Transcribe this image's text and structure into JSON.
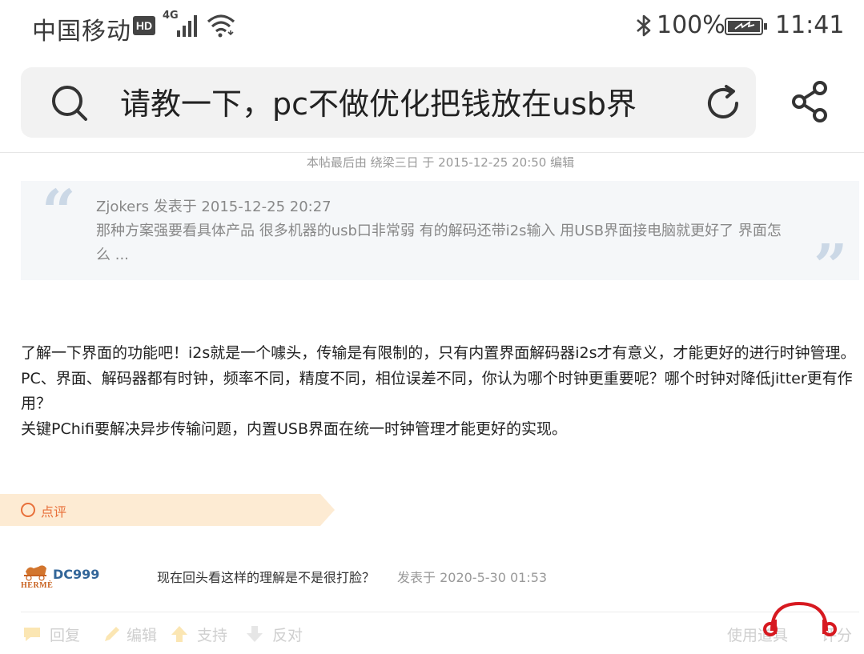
{
  "status_bar": {
    "carrier": "中国移动",
    "hd_badge": "HD",
    "network": "4G",
    "battery_percent": "100%",
    "time": "11:41"
  },
  "search_bar": {
    "query": "请教一下，pc不做优化把钱放在usb界",
    "icons": [
      "search-icon",
      "refresh-icon",
      "share-icon"
    ]
  },
  "post": {
    "edit_note": "本帖最后由 绕梁三日 于 2015-12-25 20:50 编辑",
    "quote": {
      "author_line": "Zjokers 发表于 2015-12-25 20:27",
      "text": "那种方案强要看具体产品 很多机器的usb口非常弱 有的解码还带i2s输入 用USB界面接电脑就更好了  界面怎么 ..."
    },
    "body_paragraphs": [
      "了解一下界面的功能吧！i2s就是一个噱头，传输是有限制的，只有内置界面解码器i2s才有意义，才能更好的进行时钟管理。",
      "PC、界面、解码器都有时钟，频率不同，精度不同，相位误差不同，你认为哪个时钟更重要呢？哪个时钟对降低jitter更有作用？",
      "关键PChifi要解决异步传输问题，内置USB界面在统一时钟管理才能更好的实现。"
    ]
  },
  "comments": {
    "section_label": "点评",
    "items": [
      {
        "user": "DC999",
        "avatar_text": "HERMÈ",
        "text": "现在回头看这样的理解是不是很打脸？",
        "posted": "发表于 2020-5-30 01:53"
      }
    ]
  },
  "actions": {
    "reply": "回复",
    "edit": "编辑",
    "support": "支持",
    "oppose": "反对",
    "use_tool": "使用道具",
    "rate": "评分"
  },
  "colors": {
    "accent_orange": "#e8703a",
    "username_blue": "#336699",
    "quote_bg": "#f5f7f9",
    "comment_banner": "#fdebd3",
    "logo_red": "#d71920"
  }
}
